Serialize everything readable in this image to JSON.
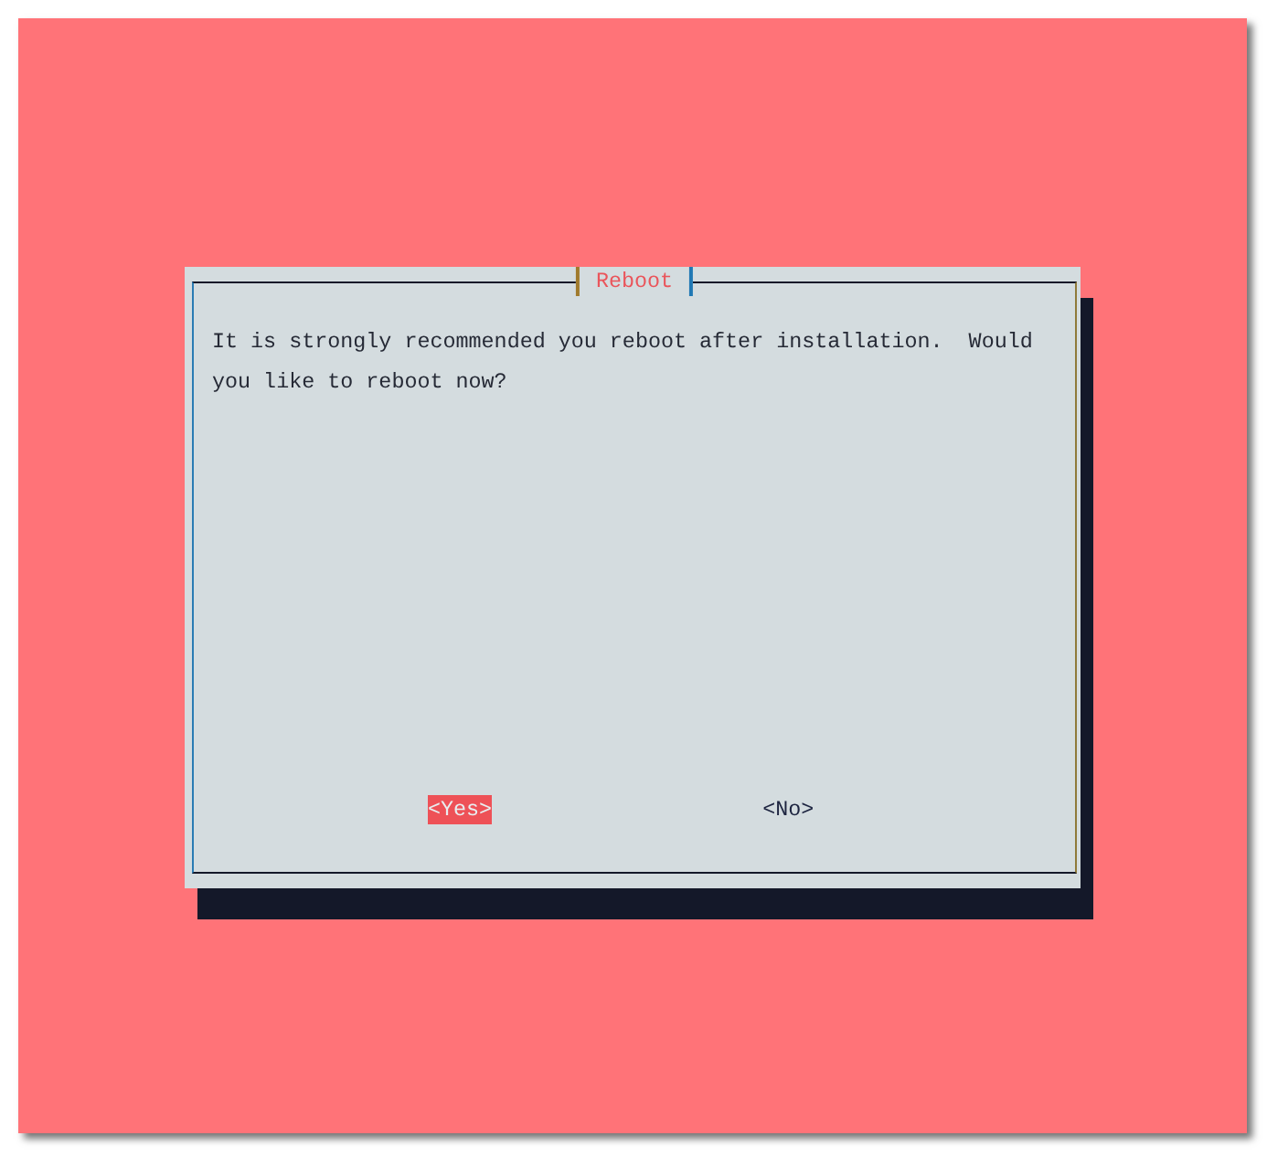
{
  "screen": {
    "dialog": {
      "title": "Reboot",
      "message": "It is strongly recommended you reboot after installation.  Would you like to reboot now?",
      "buttons": [
        {
          "label": "<Yes>",
          "selected": true
        },
        {
          "label": "<No>",
          "selected": false
        }
      ]
    }
  }
}
